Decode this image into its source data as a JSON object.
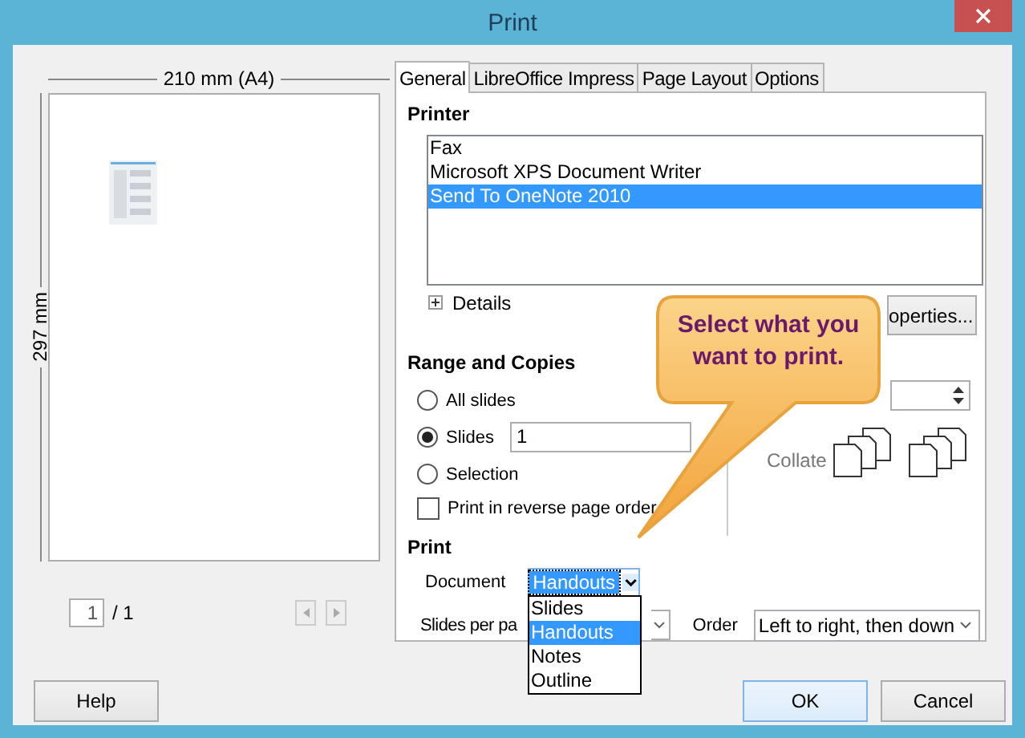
{
  "window": {
    "title": "Print"
  },
  "preview": {
    "width_label": "210 mm (A4)",
    "height_label": "297 mm",
    "page_field": "1",
    "page_count": "/ 1"
  },
  "tabs": [
    {
      "label": "General",
      "selected": true
    },
    {
      "label": "LibreOffice Impress",
      "selected": false
    },
    {
      "label": "Page Layout",
      "selected": false
    },
    {
      "label": "Options",
      "selected": false
    }
  ],
  "printer": {
    "heading": "Printer",
    "printers": [
      {
        "name": "Fax",
        "selected": false
      },
      {
        "name": "Microsoft XPS Document Writer",
        "selected": false
      },
      {
        "name": "Send To OneNote 2010",
        "selected": true
      }
    ],
    "details": "Details",
    "details_expanded": false,
    "properties_button": "operties..."
  },
  "range": {
    "heading": "Range and Copies",
    "options": [
      {
        "label": "All slides",
        "selected": false
      },
      {
        "label": "Slides",
        "selected": true,
        "value": "1"
      },
      {
        "label": "Selection",
        "selected": false
      }
    ],
    "reverse_order": {
      "label": "Print in reverse page order",
      "checked": false
    },
    "collate": "Collate"
  },
  "print": {
    "heading": "Print",
    "document_label": "Document",
    "document_value": "Handouts",
    "document_options": [
      {
        "label": "Slides",
        "selected": false
      },
      {
        "label": "Handouts",
        "selected": true
      },
      {
        "label": "Notes",
        "selected": false
      },
      {
        "label": "Outline",
        "selected": false
      }
    ],
    "slides_per_page_label": "Slides per pa",
    "order_label": "Order",
    "order_value": "Left to right, then down"
  },
  "callout": "Select what you want to print.",
  "buttons": {
    "help": "Help",
    "ok": "OK",
    "cancel": "Cancel"
  }
}
